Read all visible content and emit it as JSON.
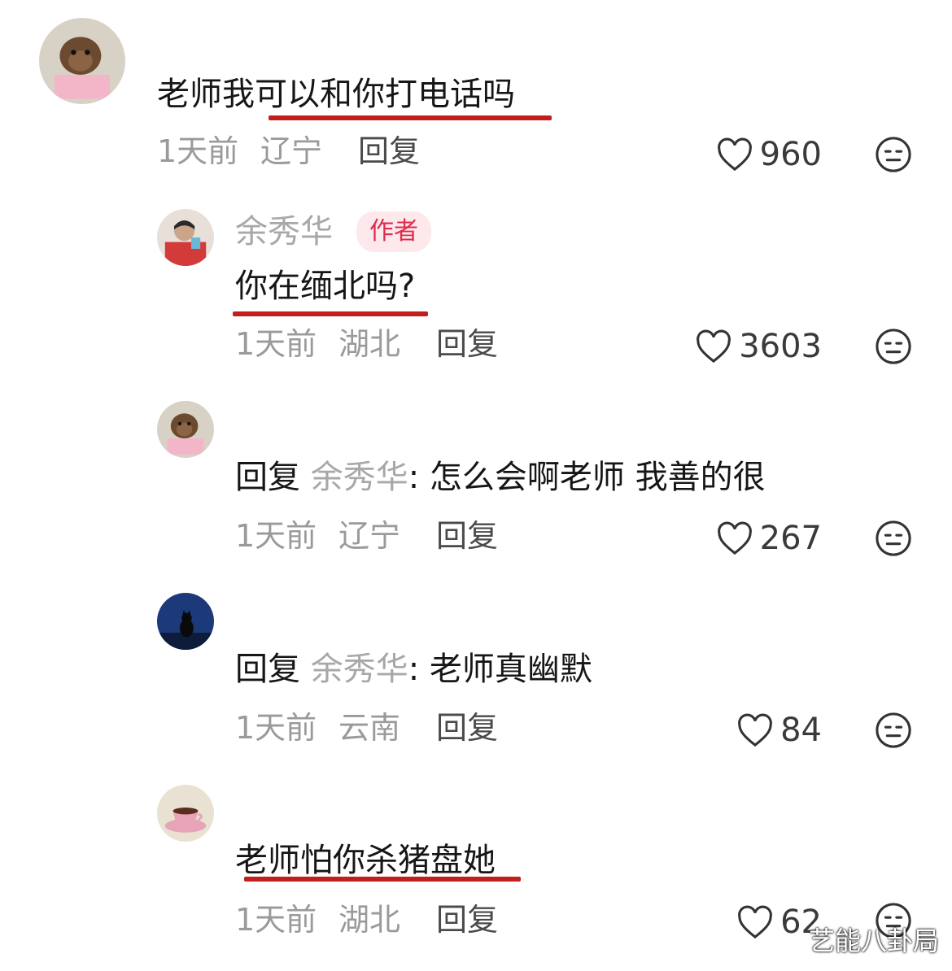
{
  "comments": [
    {
      "text": "老师我可以和你打电话吗",
      "time": "1天前",
      "location": "辽宁",
      "reply_label": "回复",
      "likes": "960"
    },
    {
      "author": "余秀华",
      "badge": "作者",
      "text": "你在缅北吗?",
      "time": "1天前",
      "location": "湖北",
      "reply_label": "回复",
      "likes": "3603"
    },
    {
      "reply_prefix": "回复",
      "reply_to": "余秀华",
      "text": ": 怎么会啊老师 我善的很",
      "time": "1天前",
      "location": "辽宁",
      "reply_label": "回复",
      "likes": "267"
    },
    {
      "reply_prefix": "回复",
      "reply_to": "余秀华",
      "text": ": 老师真幽默",
      "time": "1天前",
      "location": "云南",
      "reply_label": "回复",
      "likes": "84"
    },
    {
      "text": "老师怕你杀猪盘她",
      "time": "1天前",
      "location": "湖北",
      "reply_label": "回复",
      "likes": "62"
    }
  ],
  "watermark": "艺能八卦局",
  "colors": {
    "underline": "#c21e1e",
    "badge_text": "#e02a4c",
    "badge_bg": "#fde9ec"
  },
  "icons": {
    "like": "heart-outline-icon",
    "dislike": "neutral-face-icon"
  }
}
